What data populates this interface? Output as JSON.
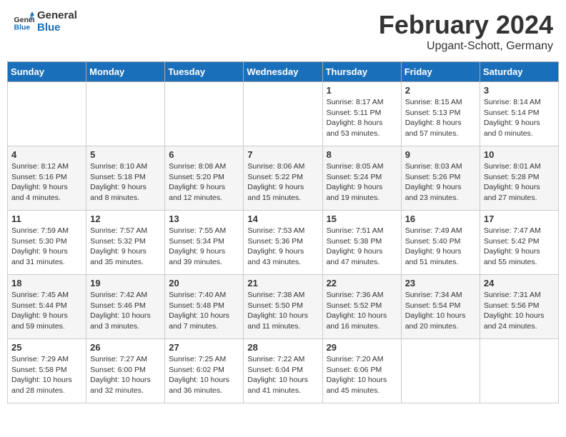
{
  "header": {
    "logo_line1": "General",
    "logo_line2": "Blue",
    "month_title": "February 2024",
    "location": "Upgant-Schott, Germany"
  },
  "days_of_week": [
    "Sunday",
    "Monday",
    "Tuesday",
    "Wednesday",
    "Thursday",
    "Friday",
    "Saturday"
  ],
  "weeks": [
    [
      {
        "day": "",
        "info": ""
      },
      {
        "day": "",
        "info": ""
      },
      {
        "day": "",
        "info": ""
      },
      {
        "day": "",
        "info": ""
      },
      {
        "day": "1",
        "info": "Sunrise: 8:17 AM\nSunset: 5:11 PM\nDaylight: 8 hours\nand 53 minutes."
      },
      {
        "day": "2",
        "info": "Sunrise: 8:15 AM\nSunset: 5:13 PM\nDaylight: 8 hours\nand 57 minutes."
      },
      {
        "day": "3",
        "info": "Sunrise: 8:14 AM\nSunset: 5:14 PM\nDaylight: 9 hours\nand 0 minutes."
      }
    ],
    [
      {
        "day": "4",
        "info": "Sunrise: 8:12 AM\nSunset: 5:16 PM\nDaylight: 9 hours\nand 4 minutes."
      },
      {
        "day": "5",
        "info": "Sunrise: 8:10 AM\nSunset: 5:18 PM\nDaylight: 9 hours\nand 8 minutes."
      },
      {
        "day": "6",
        "info": "Sunrise: 8:08 AM\nSunset: 5:20 PM\nDaylight: 9 hours\nand 12 minutes."
      },
      {
        "day": "7",
        "info": "Sunrise: 8:06 AM\nSunset: 5:22 PM\nDaylight: 9 hours\nand 15 minutes."
      },
      {
        "day": "8",
        "info": "Sunrise: 8:05 AM\nSunset: 5:24 PM\nDaylight: 9 hours\nand 19 minutes."
      },
      {
        "day": "9",
        "info": "Sunrise: 8:03 AM\nSunset: 5:26 PM\nDaylight: 9 hours\nand 23 minutes."
      },
      {
        "day": "10",
        "info": "Sunrise: 8:01 AM\nSunset: 5:28 PM\nDaylight: 9 hours\nand 27 minutes."
      }
    ],
    [
      {
        "day": "11",
        "info": "Sunrise: 7:59 AM\nSunset: 5:30 PM\nDaylight: 9 hours\nand 31 minutes."
      },
      {
        "day": "12",
        "info": "Sunrise: 7:57 AM\nSunset: 5:32 PM\nDaylight: 9 hours\nand 35 minutes."
      },
      {
        "day": "13",
        "info": "Sunrise: 7:55 AM\nSunset: 5:34 PM\nDaylight: 9 hours\nand 39 minutes."
      },
      {
        "day": "14",
        "info": "Sunrise: 7:53 AM\nSunset: 5:36 PM\nDaylight: 9 hours\nand 43 minutes."
      },
      {
        "day": "15",
        "info": "Sunrise: 7:51 AM\nSunset: 5:38 PM\nDaylight: 9 hours\nand 47 minutes."
      },
      {
        "day": "16",
        "info": "Sunrise: 7:49 AM\nSunset: 5:40 PM\nDaylight: 9 hours\nand 51 minutes."
      },
      {
        "day": "17",
        "info": "Sunrise: 7:47 AM\nSunset: 5:42 PM\nDaylight: 9 hours\nand 55 minutes."
      }
    ],
    [
      {
        "day": "18",
        "info": "Sunrise: 7:45 AM\nSunset: 5:44 PM\nDaylight: 9 hours\nand 59 minutes."
      },
      {
        "day": "19",
        "info": "Sunrise: 7:42 AM\nSunset: 5:46 PM\nDaylight: 10 hours\nand 3 minutes."
      },
      {
        "day": "20",
        "info": "Sunrise: 7:40 AM\nSunset: 5:48 PM\nDaylight: 10 hours\nand 7 minutes."
      },
      {
        "day": "21",
        "info": "Sunrise: 7:38 AM\nSunset: 5:50 PM\nDaylight: 10 hours\nand 11 minutes."
      },
      {
        "day": "22",
        "info": "Sunrise: 7:36 AM\nSunset: 5:52 PM\nDaylight: 10 hours\nand 16 minutes."
      },
      {
        "day": "23",
        "info": "Sunrise: 7:34 AM\nSunset: 5:54 PM\nDaylight: 10 hours\nand 20 minutes."
      },
      {
        "day": "24",
        "info": "Sunrise: 7:31 AM\nSunset: 5:56 PM\nDaylight: 10 hours\nand 24 minutes."
      }
    ],
    [
      {
        "day": "25",
        "info": "Sunrise: 7:29 AM\nSunset: 5:58 PM\nDaylight: 10 hours\nand 28 minutes."
      },
      {
        "day": "26",
        "info": "Sunrise: 7:27 AM\nSunset: 6:00 PM\nDaylight: 10 hours\nand 32 minutes."
      },
      {
        "day": "27",
        "info": "Sunrise: 7:25 AM\nSunset: 6:02 PM\nDaylight: 10 hours\nand 36 minutes."
      },
      {
        "day": "28",
        "info": "Sunrise: 7:22 AM\nSunset: 6:04 PM\nDaylight: 10 hours\nand 41 minutes."
      },
      {
        "day": "29",
        "info": "Sunrise: 7:20 AM\nSunset: 6:06 PM\nDaylight: 10 hours\nand 45 minutes."
      },
      {
        "day": "",
        "info": ""
      },
      {
        "day": "",
        "info": ""
      }
    ]
  ]
}
